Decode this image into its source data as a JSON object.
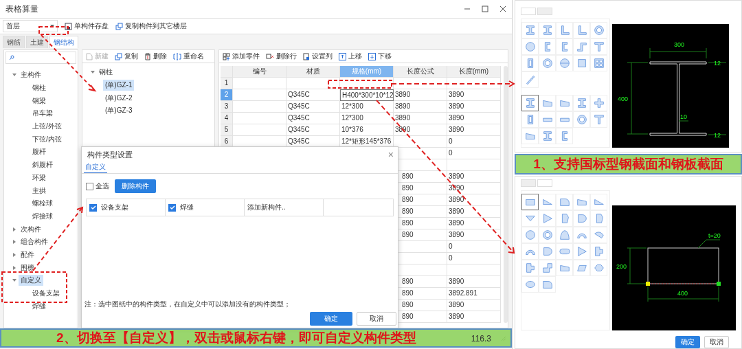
{
  "window": {
    "title": "表格算量"
  },
  "toolbar": {
    "floor": "首层",
    "save": "单构件存盘",
    "copy": "复制构件到其它楼层"
  },
  "tabs": [
    {
      "label": "钢筋",
      "selected": false
    },
    {
      "label": "土建",
      "selected": false
    },
    {
      "label": "钢结构",
      "selected": true
    }
  ],
  "category_tree": [
    {
      "label": "主构件",
      "expanded": true,
      "selected": false,
      "children": [
        {
          "label": "钢柱",
          "selected": false
        },
        {
          "label": "钢梁",
          "selected": false
        },
        {
          "label": "吊车梁",
          "selected": false
        },
        {
          "label": "上弦/外弦",
          "selected": false
        },
        {
          "label": "下弦/内弦",
          "selected": false
        },
        {
          "label": "腹杆",
          "selected": false
        },
        {
          "label": "斜腹杆",
          "selected": false
        },
        {
          "label": "环梁",
          "selected": false
        },
        {
          "label": "主拱",
          "selected": false
        },
        {
          "label": "螺栓球",
          "selected": false
        },
        {
          "label": "焊接球",
          "selected": false
        }
      ]
    },
    {
      "label": "次构件",
      "expanded": false,
      "selected": false
    },
    {
      "label": "组合构件",
      "expanded": false,
      "selected": false
    },
    {
      "label": "配件",
      "expanded": false,
      "selected": false
    },
    {
      "label": "围檩",
      "expanded": false,
      "selected": false
    },
    {
      "label": "自定义",
      "expanded": true,
      "selected": true,
      "children": [
        {
          "label": "设备支架",
          "selected": false
        },
        {
          "label": "焊缝",
          "selected": false
        }
      ]
    }
  ],
  "component_toolbar": [
    {
      "label": "新建",
      "disabled": true
    },
    {
      "label": "复制",
      "disabled": false
    },
    {
      "label": "删除",
      "disabled": false
    },
    {
      "label": "重命名",
      "disabled": false
    }
  ],
  "component_tree": {
    "label": "钢柱",
    "expanded": true,
    "children": [
      {
        "label": "(单)GZ-1",
        "selected": true
      },
      {
        "label": "(单)GZ-2",
        "selected": false
      },
      {
        "label": "(单)GZ-3",
        "selected": false
      }
    ]
  },
  "parts_toolbar": [
    "添加零件",
    "删除行",
    "设置列",
    "上移",
    "下移"
  ],
  "table": {
    "columns": [
      {
        "label": "编号",
        "selected": false
      },
      {
        "label": "材质",
        "selected": false
      },
      {
        "label": "规格(mm)",
        "selected": true
      },
      {
        "label": "长度公式",
        "selected": false
      },
      {
        "label": "长度(mm)",
        "selected": false
      }
    ],
    "rows": [
      {
        "kind": "full",
        "index": "1",
        "selected": false,
        "cells": [
          "",
          "",
          "",
          "",
          ""
        ]
      },
      {
        "kind": "full",
        "index": "2",
        "selected": true,
        "cells": [
          "",
          "Q345C",
          "H400*300*10*12",
          "3890",
          "3890"
        ]
      },
      {
        "kind": "full",
        "index": "3",
        "selected": false,
        "cells": [
          "",
          "Q345C",
          "12*300",
          "3890",
          "3890"
        ]
      },
      {
        "kind": "full",
        "index": "4",
        "selected": false,
        "cells": [
          "",
          "Q345C",
          "12*300",
          "3890",
          "3890"
        ]
      },
      {
        "kind": "full",
        "index": "5",
        "selected": false,
        "cells": [
          "",
          "Q345C",
          "10*376",
          "3890",
          "3890"
        ]
      },
      {
        "kind": "full",
        "index": "6",
        "selected": false,
        "cells": [
          "",
          "Q345C",
          "12*矩形145*376",
          "",
          "0"
        ]
      },
      {
        "kind": "covered",
        "cells": [
          "",
          "0"
        ]
      },
      {
        "kind": "covered",
        "cells": [
          "",
          ""
        ]
      },
      {
        "kind": "covered",
        "cells": [
          "890",
          "3890"
        ]
      },
      {
        "kind": "covered",
        "cells": [
          "890",
          "3890"
        ]
      },
      {
        "kind": "covered",
        "cells": [
          "890",
          "3890"
        ]
      },
      {
        "kind": "covered",
        "cells": [
          "890",
          "3890"
        ]
      },
      {
        "kind": "covered",
        "cells": [
          "890",
          "3890"
        ]
      },
      {
        "kind": "covered",
        "cells": [
          "890",
          "3890"
        ]
      },
      {
        "kind": "covered",
        "cells": [
          "",
          "0"
        ]
      },
      {
        "kind": "covered",
        "cells": [
          "",
          "0"
        ]
      },
      {
        "kind": "covered",
        "cells": [
          "",
          ""
        ]
      },
      {
        "kind": "covered",
        "cells": [
          "890",
          "3890"
        ]
      },
      {
        "kind": "covered",
        "cells": [
          "890",
          "3892.891"
        ]
      },
      {
        "kind": "covered",
        "cells": [
          "890",
          "3890"
        ]
      },
      {
        "kind": "covered",
        "cells": [
          "890",
          "3890"
        ]
      }
    ]
  },
  "dialog": {
    "title": "构件类型设置",
    "close": "×",
    "tab": "自定义",
    "select_all": {
      "label": "全选",
      "checked": false
    },
    "delete_button": "删除构件",
    "types": [
      {
        "label": "设备支架",
        "checked": true
      },
      {
        "label": "焊缝",
        "checked": true
      }
    ],
    "add_new": "添加新构件..",
    "note": "注：选中图纸中的构件类型，在自定义中可以添加没有的构件类型；",
    "ok": "确定",
    "cancel": "取消"
  },
  "status_reading": "116.3",
  "banner_bottom": "2、切换至【自定义】，双击或鼠标右键，即可自定义构件类型",
  "banner_right": "1、支持国标型钢截面和钢板截面",
  "section_panel": {
    "shapes_a": [
      {
        "selected": false
      },
      {
        "selected": false
      },
      {
        "selected": false
      },
      {
        "selected": false
      },
      {
        "selected": false
      },
      {
        "selected": false
      },
      {
        "selected": false
      },
      {
        "selected": false
      },
      {
        "selected": false
      },
      {
        "selected": false
      },
      {
        "selected": false
      },
      {
        "selected": false
      },
      {
        "selected": false
      },
      {
        "selected": false
      },
      {
        "selected": false
      },
      {
        "selected": false
      }
    ],
    "shapes_b": [
      {
        "selected": true
      },
      {
        "selected": false
      },
      {
        "selected": false
      },
      {
        "selected": false
      },
      {
        "selected": false
      },
      {
        "selected": false
      },
      {
        "selected": false
      },
      {
        "selected": false
      },
      {
        "selected": false
      },
      {
        "selected": false
      },
      {
        "selected": false
      },
      {
        "selected": false
      },
      {
        "selected": false
      }
    ],
    "dims": [
      "300",
      "12",
      "400",
      "10",
      "12"
    ]
  },
  "plate_panel": {
    "shapes": [
      {
        "selected": true
      },
      {
        "selected": false
      },
      {
        "selected": false
      },
      {
        "selected": false
      },
      {
        "selected": false
      },
      {
        "selected": false
      },
      {
        "selected": false
      },
      {
        "selected": false
      },
      {
        "selected": false
      },
      {
        "selected": false
      },
      {
        "selected": false
      },
      {
        "selected": false
      },
      {
        "selected": false
      },
      {
        "selected": false
      },
      {
        "selected": false
      },
      {
        "selected": false
      },
      {
        "selected": false
      },
      {
        "selected": false
      },
      {
        "selected": false
      },
      {
        "selected": false
      },
      {
        "selected": false
      },
      {
        "selected": false
      },
      {
        "selected": false
      },
      {
        "selected": false
      },
      {
        "selected": false
      },
      {
        "selected": false
      },
      {
        "selected": false
      }
    ],
    "dims": [
      "t=20",
      "200",
      "400"
    ],
    "ok": "确定",
    "cancel": "取消"
  }
}
